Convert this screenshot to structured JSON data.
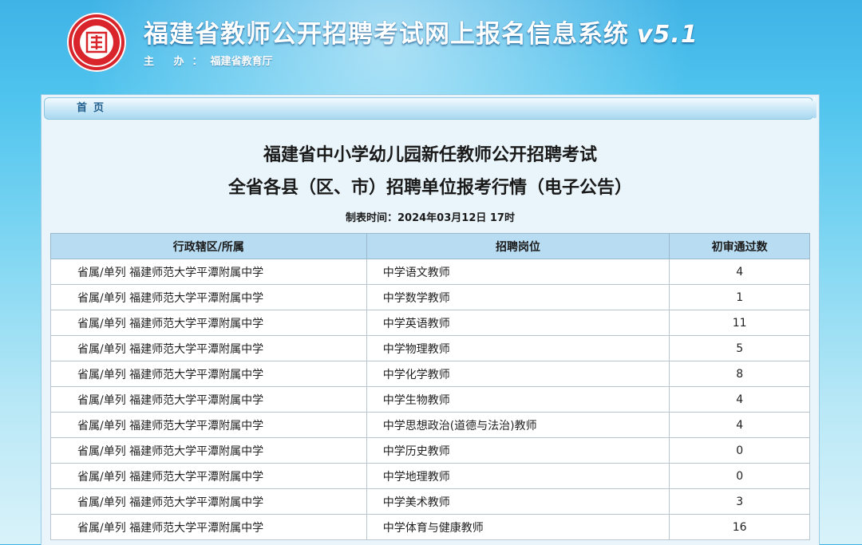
{
  "header": {
    "site_title": "福建省教师公开招聘考试网上报名信息系统",
    "version": "v5.1",
    "host_label": "主 办：",
    "host_name": "福建省教育厅"
  },
  "nav": {
    "home_label": "首页"
  },
  "notice": {
    "title_line1": "福建省中小学幼儿园新任教师公开招聘考试",
    "title_line2": "全省各县（区、市）招聘单位报考行情（电子公告）",
    "made_time": "制表时间：2024年03月12日 17时"
  },
  "table": {
    "headers": [
      "行政辖区/所属",
      "招聘岗位",
      "初审通过数"
    ],
    "rows": [
      {
        "district": "省属/单列 福建师范大学平潭附属中学",
        "position": "中学语文教师",
        "count": "4"
      },
      {
        "district": "省属/单列 福建师范大学平潭附属中学",
        "position": "中学数学教师",
        "count": "1"
      },
      {
        "district": "省属/单列 福建师范大学平潭附属中学",
        "position": "中学英语教师",
        "count": "11"
      },
      {
        "district": "省属/单列 福建师范大学平潭附属中学",
        "position": "中学物理教师",
        "count": "5"
      },
      {
        "district": "省属/单列 福建师范大学平潭附属中学",
        "position": "中学化学教师",
        "count": "8"
      },
      {
        "district": "省属/单列 福建师范大学平潭附属中学",
        "position": "中学生物教师",
        "count": "4"
      },
      {
        "district": "省属/单列 福建师范大学平潭附属中学",
        "position": "中学思想政治(道德与法治)教师",
        "count": "4"
      },
      {
        "district": "省属/单列 福建师范大学平潭附属中学",
        "position": "中学历史教师",
        "count": "0"
      },
      {
        "district": "省属/单列 福建师范大学平潭附属中学",
        "position": "中学地理教师",
        "count": "0"
      },
      {
        "district": "省属/单列 福建师范大学平潭附属中学",
        "position": "中学美术教师",
        "count": "3"
      },
      {
        "district": "省属/单列 福建师范大学平潭附属中学",
        "position": "中学体育与健康教师",
        "count": "16"
      }
    ]
  },
  "colors": {
    "header_bg": "#4fc4ee",
    "logo_red": "#d8242a",
    "table_header_bg": "#b8dcf2",
    "count_green": "#2e8b2e",
    "nav_text": "#1f5d8c"
  }
}
